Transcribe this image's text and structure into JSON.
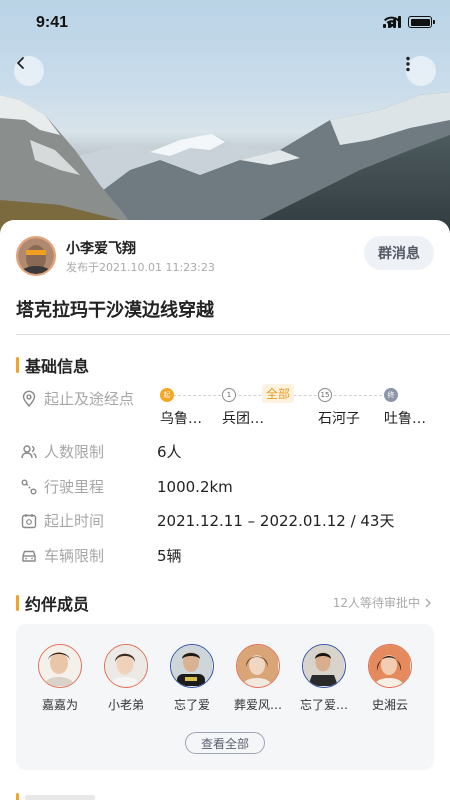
{
  "status": {
    "time": "9:41"
  },
  "author": {
    "name": "小李爱飞翔",
    "published": "发布于2021.10.01 11:23:23"
  },
  "group_button": "群消息",
  "title": "塔克拉玛干沙漠边线穿越",
  "basic": {
    "heading": "基础信息",
    "route_label": "起止及途经点",
    "all_tag": "全部",
    "stops": [
      {
        "marker": "起",
        "name": "乌鲁…"
      },
      {
        "marker": "1",
        "name": "兵团…"
      },
      {
        "marker": "15",
        "name": "石河子"
      },
      {
        "marker": "终",
        "name": "吐鲁…"
      }
    ],
    "people_label": "人数限制",
    "people_value": "6人",
    "distance_label": "行驶里程",
    "distance_value": "1000.2km",
    "time_label": "起止时间",
    "time_value": "2021.12.11 – 2022.01.12 / 43天",
    "vehicle_label": "车辆限制",
    "vehicle_value": "5辆"
  },
  "members": {
    "heading": "约伴成员",
    "pending": "12人等待审批中",
    "list": [
      {
        "name": "嘉嘉为",
        "ring": "#e36b4f"
      },
      {
        "name": "小老弟",
        "ring": "#e36b4f"
      },
      {
        "name": "忘了爱",
        "ring": "#2f4fa8"
      },
      {
        "name": "葬爱风…",
        "ring": "#e36b4f"
      },
      {
        "name": "忘了爱…",
        "ring": "#2f4fa8"
      },
      {
        "name": "史湘云",
        "ring": "#e36b4f"
      }
    ],
    "view_all": "查看全部"
  },
  "colors": {
    "accent": "#f0a52a",
    "female_ring": "#e36b4f",
    "male_ring": "#2f4fa8"
  }
}
